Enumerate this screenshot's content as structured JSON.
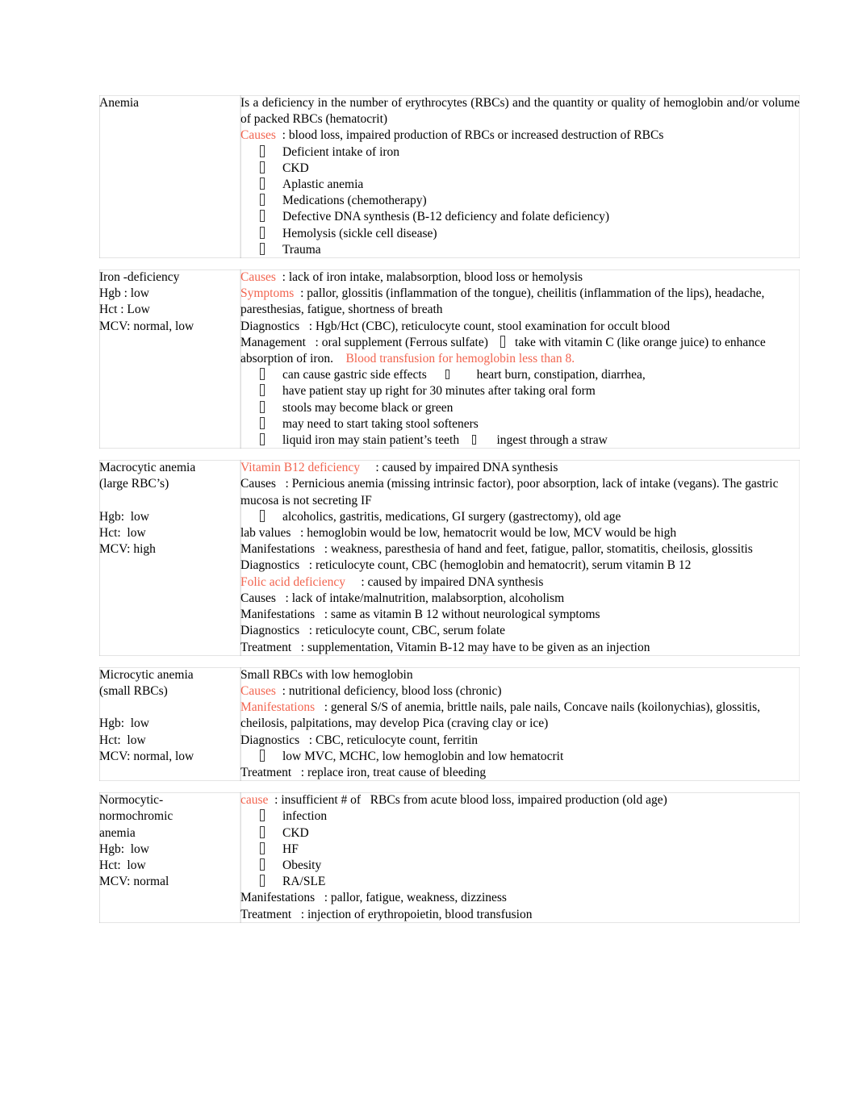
{
  "document": {
    "type": "study-notes-table",
    "accent_color": "#f2644f",
    "text_color": "#000000",
    "background_color": "#ffffff",
    "bullet_glyph": "missing-glyph-box"
  },
  "rows": [
    {
      "term": {
        "lines": [
          "Anemia"
        ]
      },
      "body": [
        {
          "kind": "justified",
          "runs": [
            {
              "text": "Is a deficiency in the "
            },
            {
              "text": "number"
            },
            {
              "text": " of erythrocytes (RBCs) and the "
            },
            {
              "text": "quantity"
            },
            {
              "text": " or quality of hemoglobin and/or "
            },
            {
              "text": "volume"
            },
            {
              "text": " of packed RBCs (hematocrit)"
            }
          ]
        },
        {
          "kind": "text",
          "runs": [
            {
              "text": "Causes",
              "accent": true
            },
            {
              "text": "  : blood loss, impaired production of RBCs or increased destruction of RBCs"
            }
          ]
        },
        {
          "kind": "bullet",
          "text": "Deficient intake of iron"
        },
        {
          "kind": "bullet",
          "text": "CKD"
        },
        {
          "kind": "bullet",
          "text": "Aplastic anemia"
        },
        {
          "kind": "bullet",
          "text": "Medications (chemotherapy)"
        },
        {
          "kind": "bullet",
          "text": "Defective DNA synthesis (B-12 deficiency and folate deficiency)"
        },
        {
          "kind": "bullet",
          "text": "Hemolysis (sickle cell disease)"
        },
        {
          "kind": "bullet",
          "text": "Trauma"
        }
      ]
    },
    {
      "term": {
        "lines": [
          "Iron -deficiency",
          "Hgb : low",
          "Hct : Low",
          "MCV: normal, low"
        ]
      },
      "body": [
        {
          "kind": "text",
          "runs": [
            {
              "text": "Causes",
              "accent": true
            },
            {
              "text": "  : lack of iron intake, malabsorption, blood loss or hemolysis"
            }
          ]
        },
        {
          "kind": "text",
          "runs": [
            {
              "text": "Symptoms",
              "accent": true
            },
            {
              "text": "  : pallor, glossitis (inflammation of the tongue), cheilitis (inflammation of the lips), headache, paresthesias, fatigue, shortness of breath"
            }
          ]
        },
        {
          "kind": "text",
          "runs": [
            {
              "text": "Diagnostics   : Hgb/Hct (CBC), reticulocyte count, stool examination for occult blood"
            }
          ]
        },
        {
          "kind": "text-tofu",
          "runs": [
            {
              "text": "Management   : oral supplement (Ferrous sulfate)    "
            },
            {
              "tofu": true
            },
            {
              "text": "   take with vitamin C (like orange juice) to enhance absorption of iron.    "
            },
            {
              "text": "Blood transfusion for hemoglobin less than 8.",
              "accent": true
            }
          ]
        },
        {
          "kind": "bullet-tofu",
          "runs": [
            {
              "text": "can cause gastric side effects      "
            },
            {
              "tofu": true,
              "small": true
            },
            {
              "text": "   heart burn, constipation, diarrhea,"
            }
          ]
        },
        {
          "kind": "bullet",
          "text": "have patient stay up right for 30 minutes after taking oral form"
        },
        {
          "kind": "bullet",
          "text": "stools may become black or green"
        },
        {
          "kind": "bullet",
          "text": "may need to start taking stool softeners"
        },
        {
          "kind": "bullet-tofu",
          "runs": [
            {
              "text": "liquid iron may stain patient’s teeth    "
            },
            {
              "tofu": true,
              "small": true
            },
            {
              "text": " ingest through a straw"
            }
          ]
        }
      ]
    },
    {
      "term": {
        "lines": [
          "Macrocytic anemia",
          "(large RBC’s)",
          "",
          "Hgb:  low",
          "Hct:  low",
          "MCV: high"
        ]
      },
      "body": [
        {
          "kind": "text",
          "runs": [
            {
              "text": "Vitamin B12 deficiency",
              "accent": true
            },
            {
              "text": "     : caused by impaired DNA synthesis"
            }
          ]
        },
        {
          "kind": "text",
          "runs": [
            {
              "text": "Causes   : Pernicious anemia (missing intrinsic factor), poor absorption, lack of intake (vegans). The gastric mucosa is not secreting IF"
            }
          ]
        },
        {
          "kind": "bullet",
          "text": "alcoholics, gastritis, medications, GI surgery (gastrectomy), old age"
        },
        {
          "kind": "text",
          "runs": [
            {
              "text": "lab values   : hemoglobin would be low, hematocrit would be low, MCV would be high"
            }
          ]
        },
        {
          "kind": "text",
          "runs": [
            {
              "text": "Manifestations   : weakness, paresthesia of hand and feet, fatigue, pallor, stomatitis, cheilosis, glossitis"
            }
          ]
        },
        {
          "kind": "text",
          "runs": [
            {
              "text": "Diagnostics   : reticulocyte count, CBC (hemoglobin and hematocrit), serum vitamin B 12"
            }
          ]
        },
        {
          "kind": "text",
          "runs": [
            {
              "text": "Folic acid deficiency",
              "accent": true
            },
            {
              "text": "     : caused by impaired DNA synthesis"
            }
          ]
        },
        {
          "kind": "text",
          "runs": [
            {
              "text": "Causes   : lack of intake/malnutrition, malabsorption, alcoholism"
            }
          ]
        },
        {
          "kind": "text",
          "runs": [
            {
              "text": "Manifestations   : same as vitamin B 12 without neurological symptoms"
            }
          ]
        },
        {
          "kind": "text",
          "runs": [
            {
              "text": "Diagnostics   : reticulocyte count, CBC, serum folate"
            }
          ]
        },
        {
          "kind": "text",
          "runs": [
            {
              "text": "Treatment   : supplementation, Vitamin B-12 may have to be given as an injection"
            }
          ]
        }
      ]
    },
    {
      "term": {
        "lines": [
          "Microcytic anemia",
          "(small RBCs)",
          "",
          "Hgb:  low",
          "Hct:  low",
          "MCV: normal, low"
        ]
      },
      "body": [
        {
          "kind": "text",
          "runs": [
            {
              "text": "Small RBCs with low hemoglobin"
            }
          ]
        },
        {
          "kind": "text",
          "runs": [
            {
              "text": "Causes",
              "accent": true
            },
            {
              "text": "  : nutritional deficiency, blood loss (chronic)"
            }
          ]
        },
        {
          "kind": "text",
          "runs": [
            {
              "text": "Manifestations",
              "accent": true
            },
            {
              "text": "   : general S/S of anemia, brittle nails, pale nails, Concave nails (koilonychias), glossitis, cheilosis, palpitations, may develop Pica (craving clay or ice)"
            }
          ]
        },
        {
          "kind": "text",
          "runs": [
            {
              "text": "Diagnostics   : CBC, reticulocyte count, ferritin"
            }
          ]
        },
        {
          "kind": "bullet",
          "text": "low MVC, MCHC, low hemoglobin and low hematocrit"
        },
        {
          "kind": "text",
          "runs": [
            {
              "text": "Treatment   : replace iron, treat cause of bleeding"
            }
          ]
        }
      ]
    },
    {
      "term": {
        "lines": [
          "Normocytic-",
          "normochromic",
          "anemia",
          "Hgb:  low",
          "Hct:  low",
          "MCV: normal"
        ]
      },
      "body": [
        {
          "kind": "text",
          "runs": [
            {
              "text": "cause",
              "accent": true
            },
            {
              "text": "  : insufficient # of   RBCs from acute blood loss, impaired production (old age)"
            }
          ]
        },
        {
          "kind": "bullet",
          "text": "infection"
        },
        {
          "kind": "bullet",
          "text": "CKD"
        },
        {
          "kind": "bullet",
          "text": "HF"
        },
        {
          "kind": "bullet",
          "text": "Obesity"
        },
        {
          "kind": "bullet",
          "text": "RA/SLE"
        },
        {
          "kind": "text",
          "runs": [
            {
              "text": "Manifestations   : pallor, fatigue, weakness, dizziness"
            }
          ]
        },
        {
          "kind": "text",
          "runs": [
            {
              "text": "Treatment   : injection of erythropoietin, blood transfusion"
            }
          ]
        }
      ]
    }
  ]
}
